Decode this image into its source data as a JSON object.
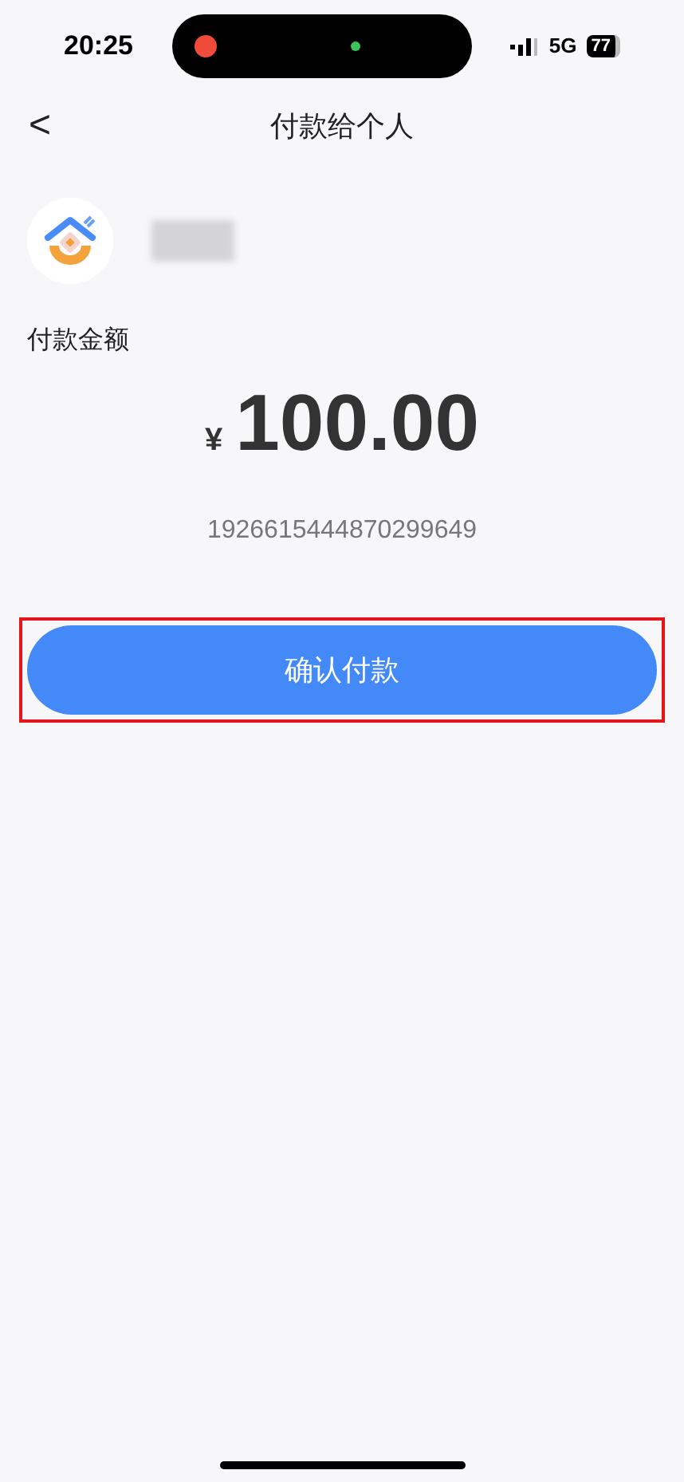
{
  "status_bar": {
    "time": "20:25",
    "network": "5G",
    "battery": "77"
  },
  "header": {
    "back": "<",
    "title": "付款给个人"
  },
  "payee": {
    "name_redacted": true
  },
  "amount_label": "付款金额",
  "amount": {
    "currency": "¥",
    "value": "100.00"
  },
  "reference": "1926615444870299649",
  "confirm_button": {
    "label": "确认付款",
    "highlighted": true
  }
}
